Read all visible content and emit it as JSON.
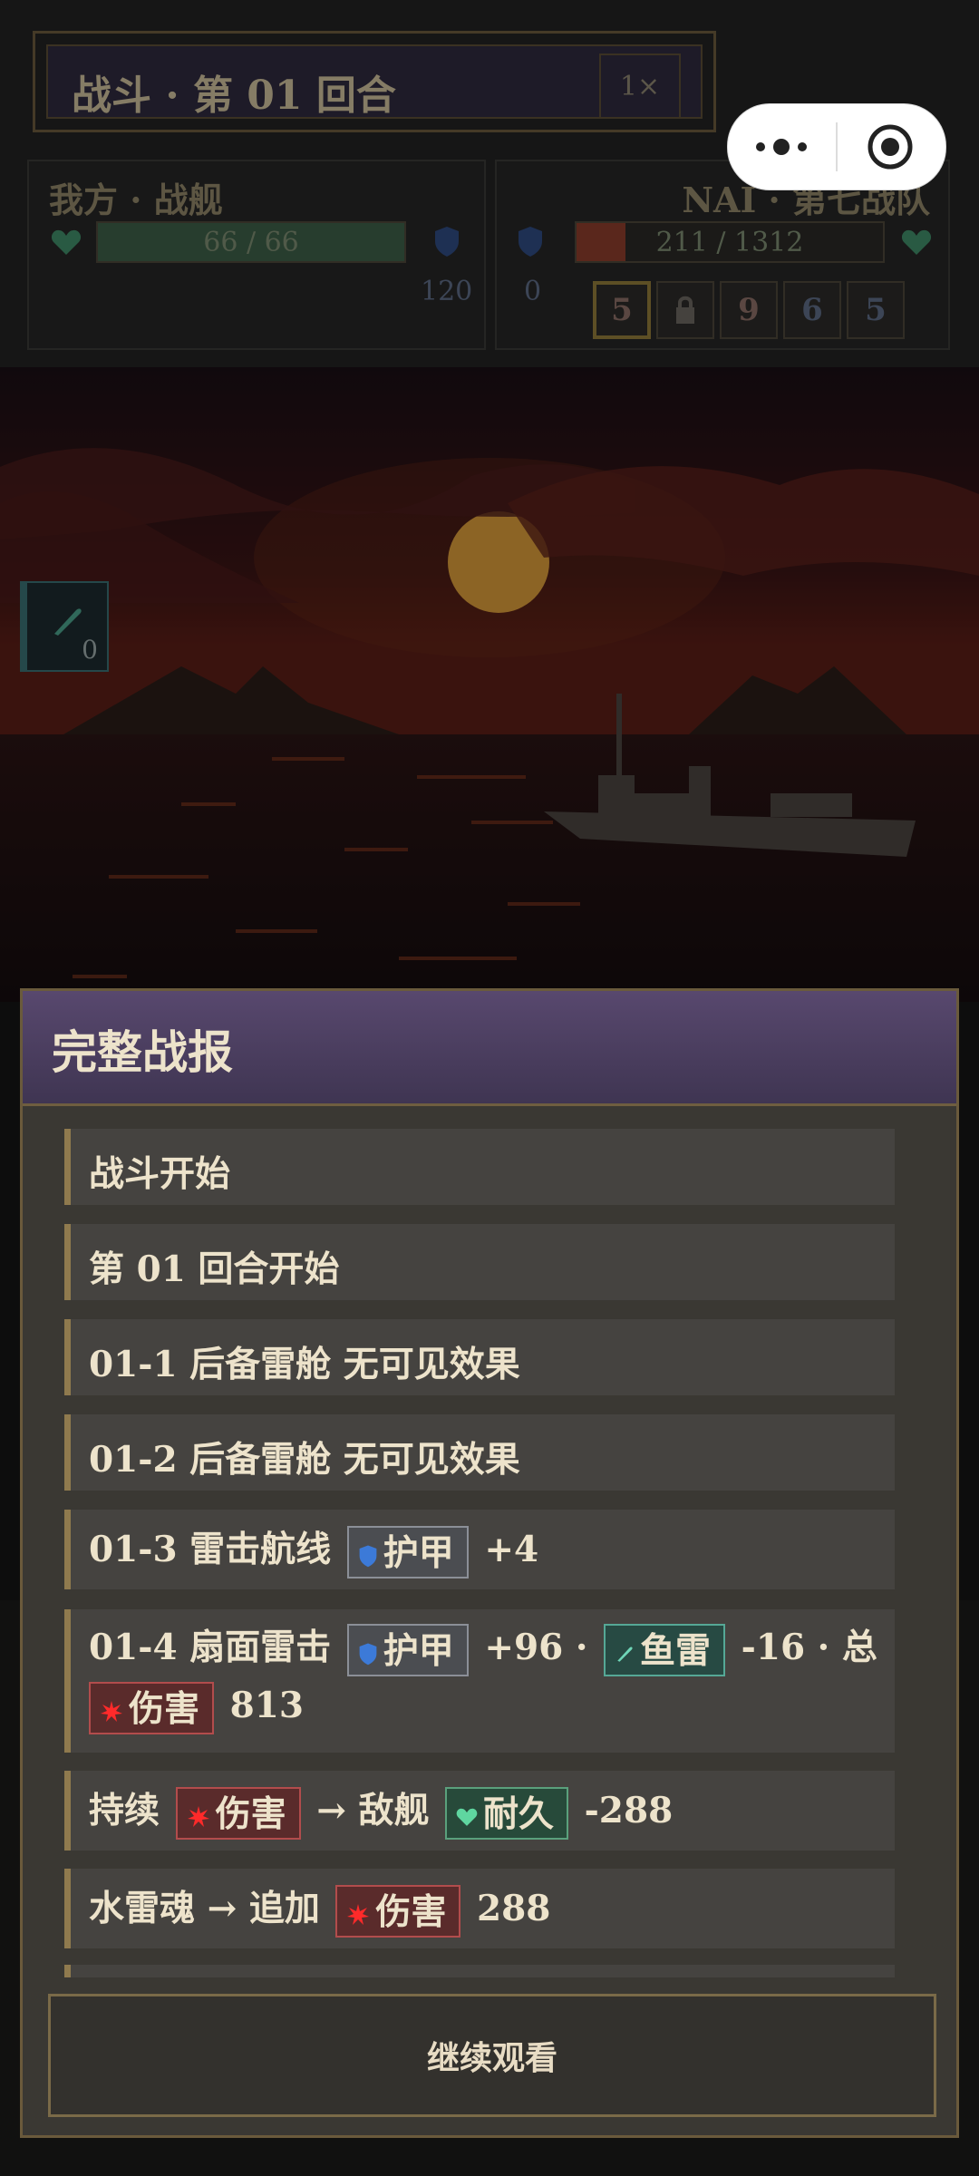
{
  "hud": {
    "battle_title": "战斗 · 第 01 回合",
    "speed": "1×",
    "player": {
      "name": "我方 · 战舰",
      "hp_text": "66 / 66",
      "hp_fraction": 1.0,
      "armor": "120"
    },
    "enemy": {
      "name": "NAI · 第七战队",
      "hp_text": "211 / 1312",
      "hp_fraction": 0.161,
      "armor": "0"
    },
    "intents": [
      "5",
      "",
      "9",
      "6",
      "5"
    ],
    "side_badge_count": "0"
  },
  "modal": {
    "title": "完整战报",
    "logs": [
      {
        "text": "战斗开始"
      },
      {
        "text": "第 01 回合开始"
      },
      {
        "text": "01-1 后备雷舱 无可见效果"
      },
      {
        "text": "01-2 后备雷舱 无可见效果"
      },
      {
        "prefix": "01-3 雷击航线",
        "armor": "护甲",
        "suffix": "+4"
      },
      {
        "prefix": "01-4 扇面雷击",
        "armor": "护甲",
        "mid1": "+96 ·",
        "torpedo": "鱼雷",
        "mid2": "-16 · 总",
        "damage": "伤害",
        "suffix": "813"
      },
      {
        "prefix": "持续",
        "damage": "伤害",
        "mid": "→ 敌舰",
        "hp": "耐久",
        "suffix": "-288"
      },
      {
        "prefix": "水雷魂 → 追加",
        "damage": "伤害",
        "suffix": "288"
      }
    ],
    "continue_label": "继续观看"
  },
  "colors": {
    "accent_gold": "#8f7a4e",
    "header_purple": "#4d3f62",
    "damage_red": "#b24c4c",
    "torpedo_teal": "#55a896",
    "hp_green": "#5aa07c"
  }
}
